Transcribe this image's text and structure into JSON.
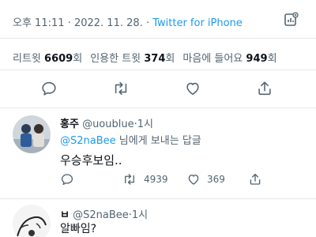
{
  "tweet": {
    "time": "오후 11:11",
    "date": "2022. 11. 28.",
    "source": "Twitter for iPhone",
    "separator": "·"
  },
  "stats": {
    "retweets_label": "리트윗",
    "retweets_value": "6609",
    "retweets_unit": "회",
    "quotes_label": "인용한 트윗",
    "quotes_value": "374",
    "quotes_unit": "회",
    "likes_label": "마음에 들어요",
    "likes_value": "949",
    "likes_unit": "회"
  },
  "actions": {
    "icons": [
      "reply-icon",
      "retweet-icon",
      "like-icon",
      "share-icon"
    ]
  },
  "replies": [
    {
      "name": "홍주",
      "handle": "@uoublue",
      "time": "1시",
      "separator": "·",
      "reply_to_mention": "@S2naBee",
      "reply_to_suffix": " 님에게 보내는 답글",
      "text": "우승후보임..",
      "counts": {
        "replies": "",
        "retweets": "4939",
        "likes": "369"
      }
    },
    {
      "name": "ㅂ",
      "handle": "@S2naBee",
      "time": "1시",
      "separator": "·",
      "text": "알빠임?"
    }
  ],
  "colors": {
    "accent": "#1d9bf0",
    "secondary_text": "#536471",
    "primary_text": "#0f1419",
    "divider": "#e6e9eb"
  }
}
